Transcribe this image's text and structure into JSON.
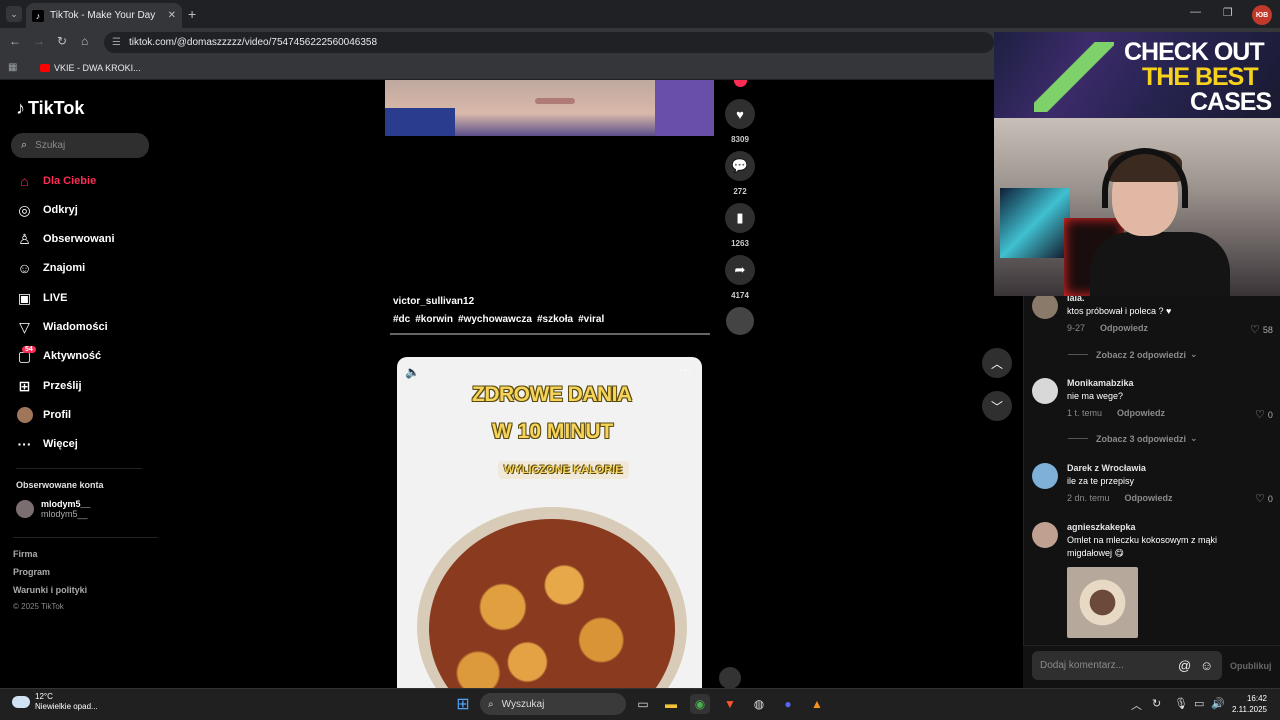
{
  "browser": {
    "tab_title": "TikTok - Make Your Day",
    "url": "tiktok.com/@domaszzzzz/video/7547456222560046358",
    "bookmark": "VKIE - DWA KROKI...",
    "profile_badge": "ЮВ"
  },
  "sidebar": {
    "logo": "TikTok",
    "search_placeholder": "Szukaj",
    "items": [
      {
        "label": "Dla Ciebie",
        "icon": "home-icon"
      },
      {
        "label": "Odkryj",
        "icon": "compass-icon"
      },
      {
        "label": "Obserwowani",
        "icon": "following-icon"
      },
      {
        "label": "Znajomi",
        "icon": "friends-icon"
      },
      {
        "label": "LIVE",
        "icon": "live-icon"
      },
      {
        "label": "Wiadomości",
        "icon": "send-icon"
      },
      {
        "label": "Aktywność",
        "icon": "activity-icon"
      },
      {
        "label": "Prześlij",
        "icon": "upload-icon"
      },
      {
        "label": "Profil",
        "icon": "profile-avatar"
      },
      {
        "label": "Więcej",
        "icon": "more-icon"
      }
    ],
    "activity_badge": "54",
    "followed_header": "Obserwowane konta",
    "followed": [
      {
        "name": "mlodym5__",
        "handle": "mlodym5__"
      }
    ],
    "footer_links": [
      "Firma",
      "Program",
      "Warunki i polityki"
    ],
    "copyright": "© 2025 TikTok"
  },
  "video1": {
    "author": "victor_sullivan12",
    "tags": [
      "#dc",
      "#korwin",
      "#wychowawcza",
      "#szkoła",
      "#viral"
    ],
    "likes": "8309",
    "comments": "272",
    "saves": "1263",
    "shares": "4174"
  },
  "video2": {
    "line1": "ZDROWE DANIA",
    "line2": "W 10 MINUT",
    "line3": "WYLICZONE KALORIE"
  },
  "comments": [
    {
      "name": "lala.",
      "text": "ktos próbował i poleca ? ♥",
      "date": "9-27",
      "reply": "Odpowiedz",
      "likes": "58",
      "more": "Zobacz 2 odpowiedzi"
    },
    {
      "name": "Monikamabzika",
      "text": "nie ma wege?",
      "date": "1 t. temu",
      "reply": "Odpowiedz",
      "likes": "0",
      "more": "Zobacz 3 odpowiedzi"
    },
    {
      "name": "Darek z Wrocławia",
      "text": "ile za te przepisy",
      "date": "2 dn. temu",
      "reply": "Odpowiedz",
      "likes": "0"
    },
    {
      "name": "agnieszkakepka",
      "text": "Omlet na mleczku kokosowym z mąki migdałowej 😋"
    }
  ],
  "comment_input": {
    "placeholder": "Dodaj komentarz...",
    "publish": "Opublikuj"
  },
  "overlay": {
    "line1": "CHECK OUT",
    "line2": "THE BEST",
    "line3": "CASES"
  },
  "taskbar": {
    "weather_temp": "12°C",
    "weather_desc": "Niewielkie opad...",
    "search": "Wyszukaj",
    "time": "16:42",
    "date": "2.11.2025"
  }
}
